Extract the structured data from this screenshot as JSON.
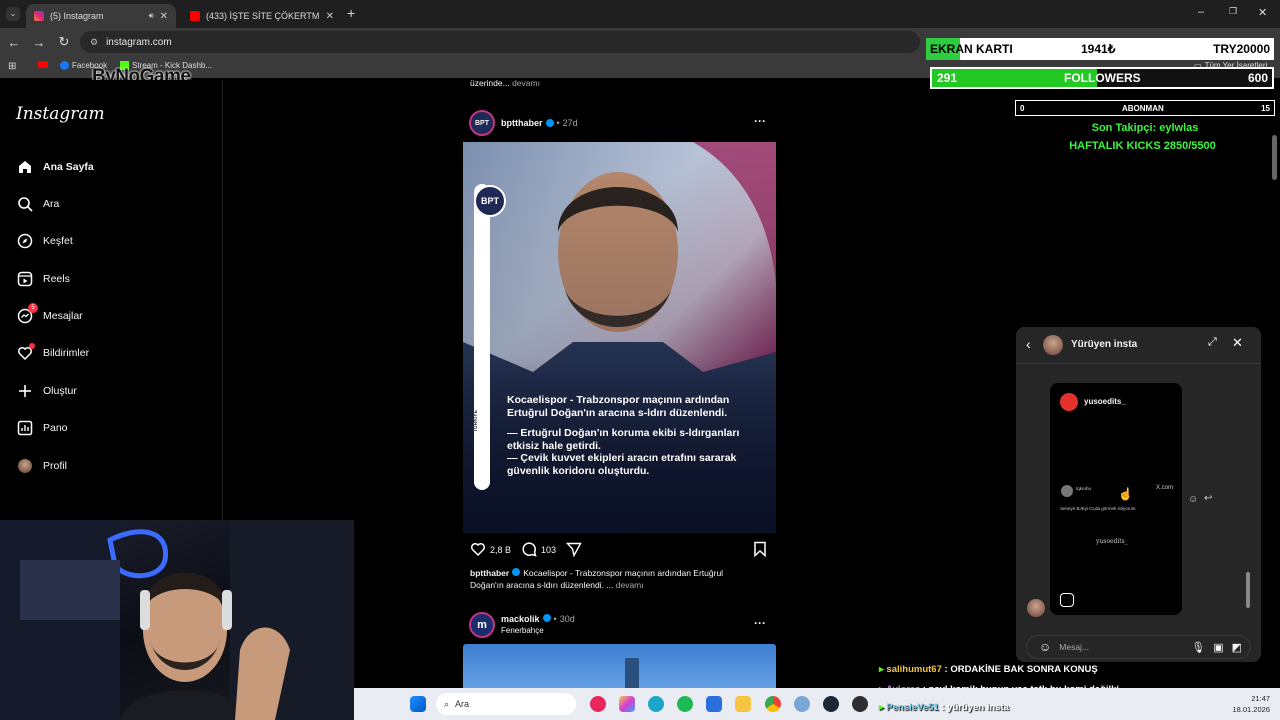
{
  "browser": {
    "tabs": [
      {
        "title": "(5) Instagram",
        "active": true
      },
      {
        "title": "(433) İŞTE SİTE ÇÖKERTMEK BU",
        "active": false
      }
    ],
    "url": "instagram.com",
    "bookmarks": [
      "Facebook",
      "Stream - Kick Dashb..."
    ],
    "bookmarks_right": "Tüm Yer İşaretleri",
    "watermark": "ByNoGame"
  },
  "instagram": {
    "logo": "Instagram",
    "nav": [
      {
        "label": "Ana Sayfa",
        "icon": "home-icon"
      },
      {
        "label": "Ara",
        "icon": "search-icon"
      },
      {
        "label": "Keşfet",
        "icon": "compass-icon"
      },
      {
        "label": "Reels",
        "icon": "reels-icon"
      },
      {
        "label": "Mesajlar",
        "icon": "messenger-icon",
        "badge": "5"
      },
      {
        "label": "Bildirimler",
        "icon": "heart-icon"
      },
      {
        "label": "Oluştur",
        "icon": "plus-icon"
      },
      {
        "label": "Pano",
        "icon": "dashboard-icon"
      },
      {
        "label": "Profil",
        "icon": "profile-avatar"
      }
    ]
  },
  "feed": {
    "top_caption": "üzerinde...",
    "top_more": "devamı",
    "post1": {
      "user": "bptthaber",
      "sep": "•",
      "time": "27d",
      "brand": "BPT",
      "side_label": "TÜRKİYE",
      "overlay_lines": [
        "Kocaelispor - Trabzonspor maçının ardından",
        "Ertuğrul Doğan'ın aracına s-ldırı düzenlendi.",
        "",
        "— Ertuğrul Doğan'ın koruma ekibi s-ldırganları",
        "etkisiz hale getirdi.",
        "— Çevik kuvvet ekipleri aracın etrafını sararak",
        "güvenlik koridoru oluşturdu."
      ],
      "likes": "2,8 B",
      "comments": "103",
      "caption_user": "bptthaber",
      "caption_line1": "Kocaelispor - Trabzonspor maçının ardından Ertuğrul",
      "caption_line2": "Doğan'ın aracına s-ldırı düzenlendi. ...",
      "caption_more": "devamı"
    },
    "post2": {
      "user": "mackolik",
      "sep": "•",
      "time": "30d",
      "subtitle": "Fenerbahçe",
      "avatar_letter": "m"
    }
  },
  "stream_overlay": {
    "ekran_label": "EKRAN KARTI",
    "ekran_value": "1941₺",
    "ekran_target": "TRY20000",
    "ekran_progress": 0.097,
    "followers_current": "291",
    "followers_label": "FOLLOWERS",
    "followers_target": "600",
    "followers_progress": 0.485,
    "abonman_current": "0",
    "abonman_label": "ABONMAN",
    "abonman_target": "15",
    "last_follower": "Son Takipçi: eylwlas",
    "weekly_kicks": "HAFTALIK KICKS 2850/5500"
  },
  "dm_popup": {
    "title": "Yürüyen insta",
    "shared_user": "yusoedits_",
    "shared_handle": "tqkruhu",
    "shared_domain": "X.com",
    "shared_text": "Seneye BJKyi CLda görmek istiyorum",
    "shared_sign": "yusoedits_",
    "input_placeholder": "Mesaj..."
  },
  "stream_chat": [
    {
      "user": "salihumut67",
      "text": "ORDAKİNE BAK SONRA KONUŞ",
      "color": "#f5c542"
    },
    {
      "user": "Ayloraz",
      "text": "neyl komik bunun yaa tatlı bu komi değilki",
      "color": "#c67ae6"
    },
    {
      "user": "PensieVe51",
      "text": "yürüyen insta",
      "color": "#7ad4f5"
    }
  ],
  "taskbar": {
    "search_placeholder": "Ara",
    "time": "21:47",
    "date": "18.01.2026"
  }
}
